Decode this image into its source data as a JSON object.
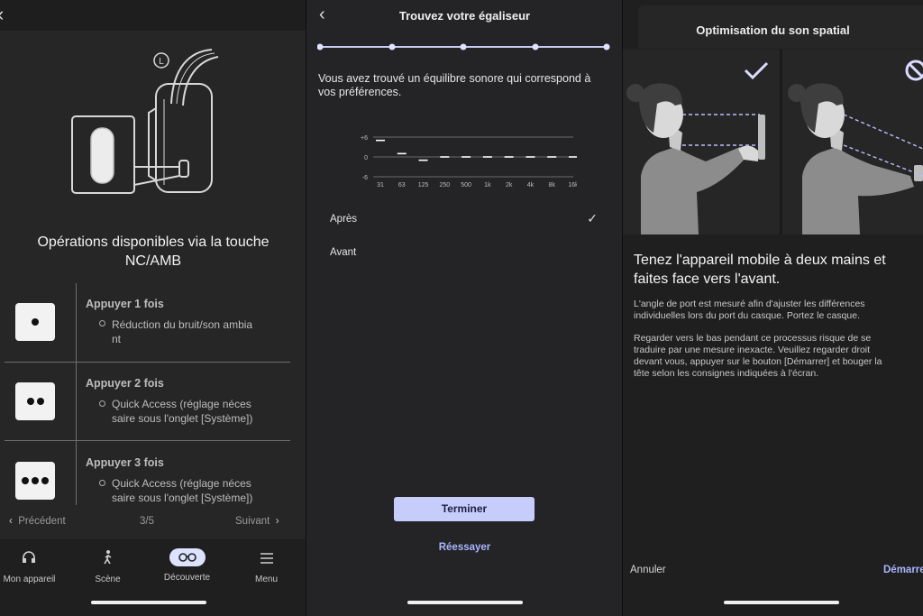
{
  "panel1": {
    "back_icon": "chevron-left-icon",
    "side_label": "L",
    "title_line1": "Opérations disponibles via la touche",
    "title_line2": "NC/AMB",
    "operations": [
      {
        "title": "Appuyer 1 fois",
        "desc_line1": "Réduction du bruit/son ambia",
        "desc_line2": "nt",
        "dots": 1
      },
      {
        "title": "Appuyer 2 fois",
        "desc_line1": "Quick Access (réglage néces",
        "desc_line2": "saire sous l'onglet [Système])",
        "dots": 2
      },
      {
        "title": "Appuyer 3 fois",
        "desc_line1": "Quick Access (réglage néces",
        "desc_line2": "saire sous l'onglet [Système])",
        "dots": 3
      }
    ],
    "pager": {
      "prev": "Précédent",
      "page": "3/5",
      "next": "Suivant"
    },
    "tabs": [
      {
        "label": "Mon appareil",
        "icon": "headphones-device-icon"
      },
      {
        "label": "Scène",
        "icon": "walking-person-icon"
      },
      {
        "label": "Découverte",
        "icon": "binoculars-icon",
        "active": true
      },
      {
        "label": "Menu",
        "icon": "menu-icon"
      }
    ]
  },
  "panel2": {
    "title": "Trouvez votre égaliseur",
    "progress_steps": 5,
    "message_line1": "Vous avez trouvé un équilibre sonore qui correspond à",
    "message_line2": "vos préférences.",
    "options": [
      {
        "label": "Après",
        "selected": true
      },
      {
        "label": "Avant",
        "selected": false
      }
    ],
    "primary_button": "Terminer",
    "secondary_button": "Réessayer"
  },
  "chart_data": {
    "type": "bar",
    "categories": [
      "31",
      "63",
      "125",
      "250",
      "500",
      "1k",
      "2k",
      "4k",
      "8k",
      "16k"
    ],
    "values": [
      5,
      1,
      -1,
      0,
      0,
      0,
      0,
      0,
      0,
      0
    ],
    "yticks": [
      "+6",
      "0",
      "-6"
    ],
    "ylim": [
      -6,
      6
    ],
    "grid": true,
    "colors": {
      "mark": "#ffffff",
      "grid": "#6a6a6a"
    }
  },
  "panel3": {
    "title": "Optimisation du son spatial",
    "illustrations": [
      {
        "state": "correct",
        "icon": "checkmark-icon"
      },
      {
        "state": "incorrect",
        "icon": "prohibited-icon"
      }
    ],
    "heading_line1": "Tenez l'appareil mobile à deux mains et",
    "heading_line2": "faites face vers l'avant.",
    "para1_line1": "L'angle de port est mesuré afin d'ajuster les différences",
    "para1_line2": "individuelles lors du port du casque. Portez le casque.",
    "para2_line1": "Regarder vers le bas pendant ce processus risque de se",
    "para2_line2": "traduire par une mesure inexacte. Veuillez regarder droit",
    "para2_line3": "devant vous, appuyer sur le bouton [Démarrer] et bouger la",
    "para2_line4": "tête selon les consignes indiquées à l'écran.",
    "cancel": "Annuler",
    "start": "Démarrer"
  },
  "colors": {
    "accent": "#a9b6ff",
    "button": "#c7cdfb",
    "background": "#262626"
  }
}
